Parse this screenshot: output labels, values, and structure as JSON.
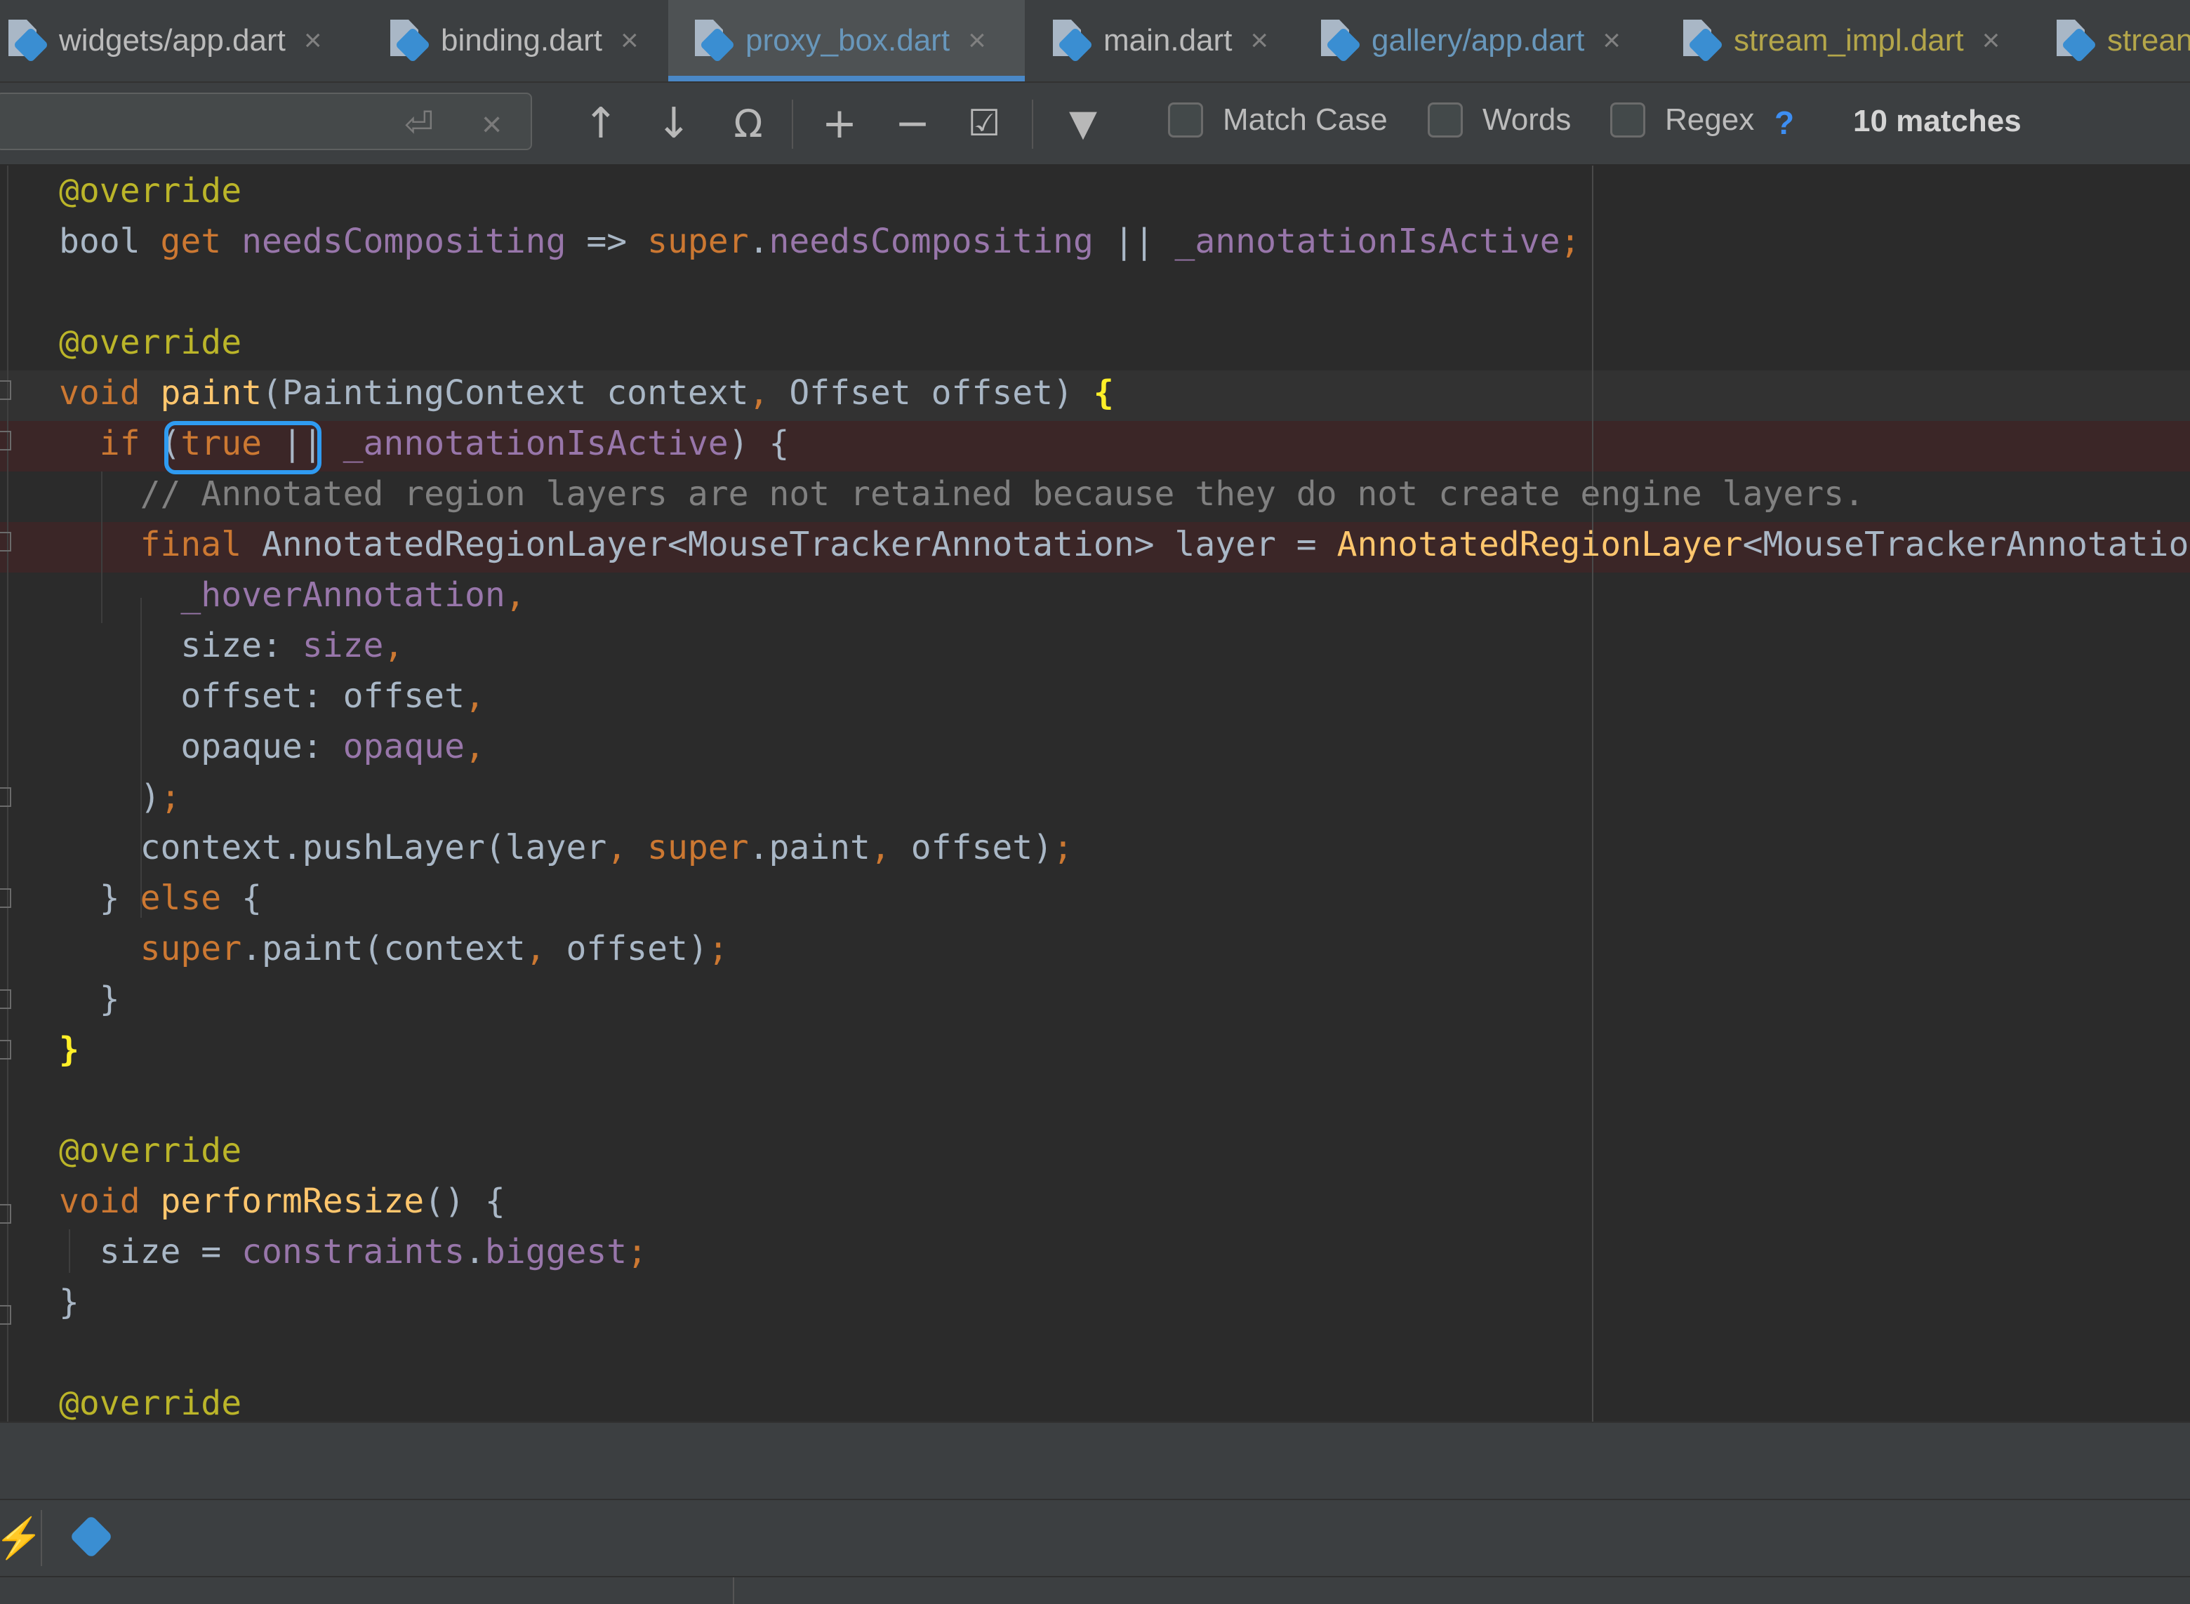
{
  "tabs": [
    {
      "label": "widgets/app.dart",
      "active": false,
      "state": "normal"
    },
    {
      "label": "binding.dart",
      "active": false,
      "state": "normal"
    },
    {
      "label": "proxy_box.dart",
      "active": true,
      "state": "active"
    },
    {
      "label": "main.dart",
      "active": false,
      "state": "normal"
    },
    {
      "label": "gallery/app.dart",
      "active": false,
      "state": "modified"
    },
    {
      "label": "stream_impl.dart",
      "active": false,
      "state": "warning"
    },
    {
      "label": "strean",
      "active": false,
      "state": "warning"
    }
  ],
  "tab_close_glyph": "×",
  "find": {
    "query": "",
    "match_case": {
      "label": "Match Case",
      "checked": false
    },
    "words": {
      "label": "Words",
      "checked": false
    },
    "regex": {
      "label": "Regex",
      "checked": false
    },
    "help": "?",
    "match_count": "10 matches",
    "buttons": {
      "history": "⏎",
      "clear": "×",
      "prev": "↑",
      "next": "↓",
      "select_all": "Ω",
      "add_occurrence": "+",
      "remove_occurrence": "−",
      "select_all_occurrences": "☑",
      "filter": "▼"
    }
  },
  "code": [
    [
      [
        "@override",
        "an"
      ]
    ],
    [
      [
        "bool ",
        ""
      ],
      [
        "get ",
        "kw"
      ],
      [
        "needsCompositing ",
        "fld"
      ],
      [
        "=> ",
        ""
      ],
      [
        "super",
        "kw"
      ],
      [
        ".",
        ""
      ],
      [
        "needsCompositing ",
        "fld"
      ],
      [
        "|| ",
        ""
      ],
      [
        "_annotationIsActive",
        "fld"
      ],
      [
        ";",
        "kw"
      ]
    ],
    [],
    [
      [
        "@override",
        "an"
      ]
    ],
    [
      [
        "void ",
        "kw"
      ],
      [
        "paint",
        "fn"
      ],
      [
        "(PaintingContext context",
        ""
      ],
      [
        ", ",
        "kw"
      ],
      [
        "Offset offset) ",
        ""
      ],
      [
        "{",
        "br"
      ]
    ],
    [
      [
        "  ",
        ""
      ],
      [
        "if ",
        "kw"
      ],
      [
        "(",
        ""
      ],
      [
        "true ",
        "kw"
      ],
      [
        "||",
        ""
      ],
      [
        " ",
        ""
      ],
      [
        "_annotationIsActive",
        "fld"
      ],
      [
        ") {",
        ""
      ]
    ],
    [
      [
        "    // Annotated region layers are not retained because they do not create engine layers.",
        "cm"
      ]
    ],
    [
      [
        "    ",
        ""
      ],
      [
        "final ",
        "kw"
      ],
      [
        "AnnotatedRegionLayer<MouseTrackerAnnotation> layer = ",
        ""
      ],
      [
        "AnnotatedRegionLayer",
        "fn"
      ],
      [
        "<MouseTrackerAnnotation>(",
        ""
      ]
    ],
    [
      [
        "      ",
        ""
      ],
      [
        "_hoverAnnotation",
        "fld"
      ],
      [
        ",",
        "kw"
      ]
    ],
    [
      [
        "      size: ",
        ""
      ],
      [
        "size",
        "fld"
      ],
      [
        ",",
        "kw"
      ]
    ],
    [
      [
        "      offset: offset",
        ""
      ],
      [
        ",",
        "kw"
      ]
    ],
    [
      [
        "      opaque: ",
        ""
      ],
      [
        "opaque",
        "fld"
      ],
      [
        ",",
        "kw"
      ]
    ],
    [
      [
        "    )",
        ""
      ],
      [
        ";",
        "kw"
      ]
    ],
    [
      [
        "    context.pushLayer(layer",
        ""
      ],
      [
        ", ",
        "kw"
      ],
      [
        "super",
        "kw"
      ],
      [
        ".paint",
        ""
      ],
      [
        ", ",
        "kw"
      ],
      [
        "offset)",
        ""
      ],
      [
        ";",
        "kw"
      ]
    ],
    [
      [
        "  } ",
        ""
      ],
      [
        "else ",
        "kw"
      ],
      [
        "{",
        ""
      ]
    ],
    [
      [
        "    ",
        ""
      ],
      [
        "super",
        "kw"
      ],
      [
        ".paint(context",
        ""
      ],
      [
        ", ",
        "kw"
      ],
      [
        "offset)",
        ""
      ],
      [
        ";",
        "kw"
      ]
    ],
    [
      [
        "  }",
        ""
      ]
    ],
    [
      [
        "}",
        "br"
      ]
    ],
    [],
    [
      [
        "@override",
        "an"
      ]
    ],
    [
      [
        "void ",
        "kw"
      ],
      [
        "performResize",
        "fn"
      ],
      [
        "() {",
        ""
      ]
    ],
    [
      [
        "  size = ",
        ""
      ],
      [
        "constraints",
        "fld"
      ],
      [
        ".",
        ""
      ],
      [
        "biggest",
        "fld"
      ],
      [
        ";",
        "kw"
      ]
    ],
    [
      [
        "}",
        ""
      ]
    ],
    [],
    [
      [
        "@override",
        "an"
      ]
    ]
  ],
  "colors": {
    "background": "#2b2b2b",
    "keyword": "#cc7832",
    "annotation": "#bbb529",
    "function": "#ffc66d",
    "field": "#9876aa",
    "comment": "#808080",
    "match_outline": "#2f9bf1"
  },
  "icons": {
    "file": "dart-file-icon",
    "status_left": "lightning-icon",
    "status_dart": "dart-icon"
  }
}
